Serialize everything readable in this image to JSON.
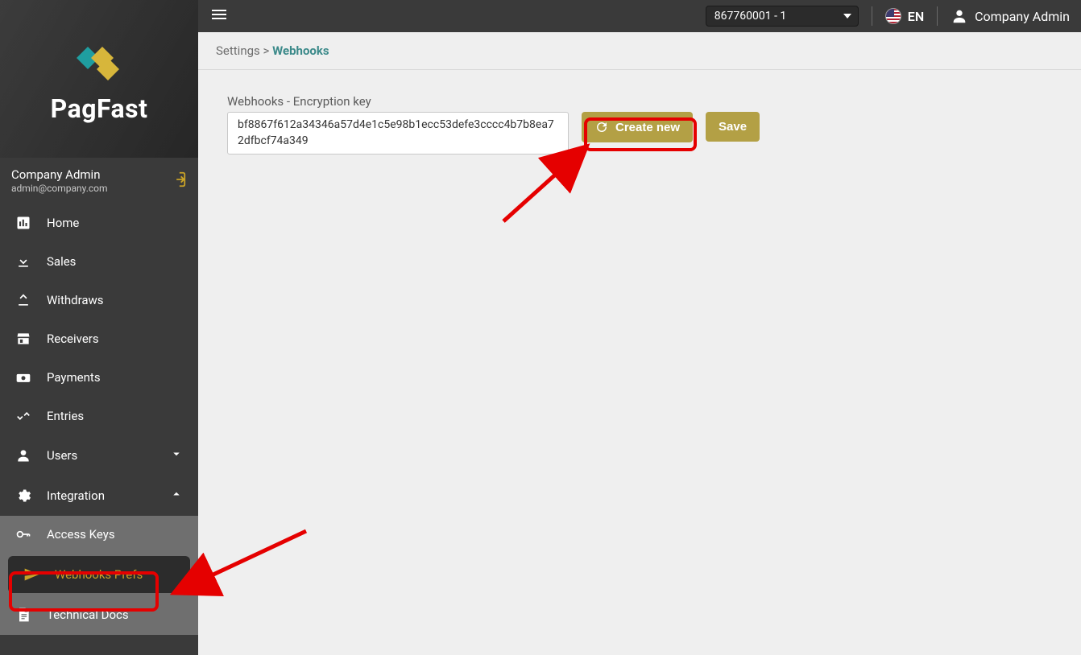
{
  "brand": {
    "name": "PagFast"
  },
  "sidebarUser": {
    "name": "Company Admin",
    "email": "admin@company.com"
  },
  "nav": {
    "home": "Home",
    "sales": "Sales",
    "withdraws": "Withdraws",
    "receivers": "Receivers",
    "payments": "Payments",
    "entries": "Entries",
    "users": "Users",
    "integration": "Integration",
    "accessKeys": "Access Keys",
    "webhooksPrefs": "Webhooks Prefs",
    "technicalDocs": "Technical Docs"
  },
  "topbar": {
    "accountSelected": "867760001 - 1",
    "lang": "EN",
    "userName": "Company Admin"
  },
  "breadcrumb": {
    "root": "Settings",
    "sep": ">",
    "current": "Webhooks"
  },
  "form": {
    "label": "Webhooks - Encryption key",
    "keyValue": "bf8867f612a34346a57d4e1c5e98b1ecc53defe3cccc4b7b8ea72dfbcf74a349",
    "createNew": "Create new",
    "save": "Save"
  }
}
